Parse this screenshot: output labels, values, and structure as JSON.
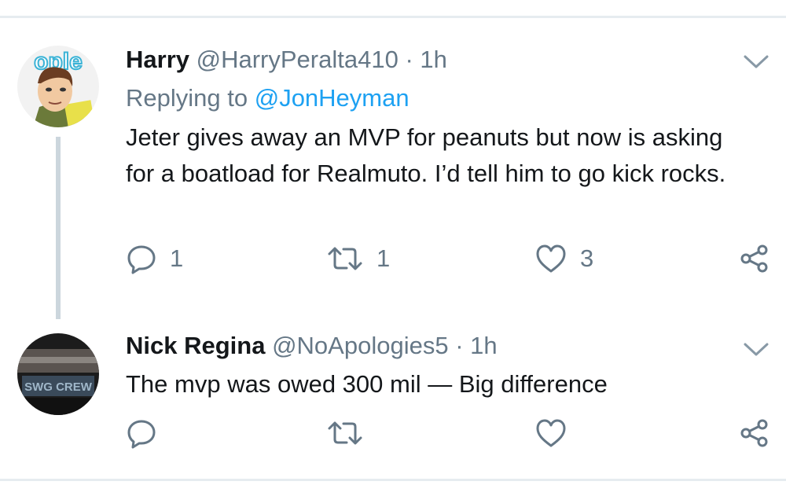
{
  "tweets": [
    {
      "name": "Harry",
      "handle": "@HarryPeralta410",
      "dot": "·",
      "time": "1h",
      "replying_prefix": "Replying to",
      "replying_to": "@JonHeyman",
      "text": "Jeter gives away an MVP for peanuts but now is asking for a boatload for Realmuto. I’d tell him to go kick rocks.",
      "replies": "1",
      "retweets": "1",
      "likes": "3",
      "avatar_icon": "cartoon-avatar"
    },
    {
      "name": "Nick Regina",
      "handle": "@NoApologies5",
      "dot": "·",
      "time": "1h",
      "text": "The mvp was owed 300 mil — Big difference",
      "avatar_icon": "graffiti-photo-avatar"
    }
  ],
  "colors": {
    "text": "#14171a",
    "secondary": "#657786",
    "link": "#1da1f2",
    "divider": "#e6ecf0",
    "icon": "#657786"
  }
}
